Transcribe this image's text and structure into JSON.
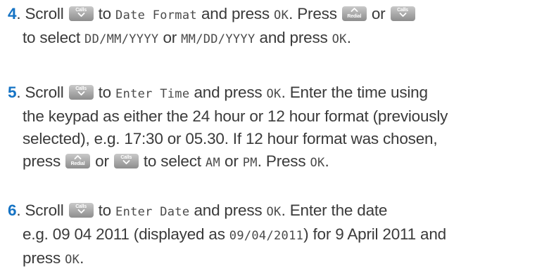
{
  "steps": [
    {
      "number": "4",
      "lines": [
        [
          {
            "t": "txt",
            "v": "Scroll "
          },
          {
            "t": "key",
            "k": "calls"
          },
          {
            "t": "txt",
            "v": " to "
          },
          {
            "t": "lcd",
            "v": "Date Format"
          },
          {
            "t": "txt",
            "v": " and press "
          },
          {
            "t": "lcd",
            "v": "OK"
          },
          {
            "t": "txt",
            "v": ". Press "
          },
          {
            "t": "key",
            "k": "redial"
          },
          {
            "t": "txt",
            "v": " or "
          },
          {
            "t": "key",
            "k": "calls"
          }
        ],
        [
          {
            "t": "txt",
            "v": "to select "
          },
          {
            "t": "lcd",
            "v": "DD/MM/YYYY"
          },
          {
            "t": "txt",
            "v": " or "
          },
          {
            "t": "lcd",
            "v": "MM/DD/YYYY"
          },
          {
            "t": "txt",
            "v": " and press "
          },
          {
            "t": "lcd",
            "v": "OK"
          },
          {
            "t": "txt",
            "v": "."
          }
        ]
      ]
    },
    {
      "number": "5",
      "lines": [
        [
          {
            "t": "txt",
            "v": "Scroll "
          },
          {
            "t": "key",
            "k": "calls"
          },
          {
            "t": "txt",
            "v": " to "
          },
          {
            "t": "lcd",
            "v": "Enter Time"
          },
          {
            "t": "txt",
            "v": " and press "
          },
          {
            "t": "lcd",
            "v": "OK"
          },
          {
            "t": "txt",
            "v": ". Enter the time using"
          }
        ],
        [
          {
            "t": "txt",
            "v": "the keypad as either the 24 hour or 12 hour format (previously"
          }
        ],
        [
          {
            "t": "txt",
            "v": "selected), e.g. 17:30 or 05.30. If 12 hour format was chosen,"
          }
        ],
        [
          {
            "t": "txt",
            "v": "press "
          },
          {
            "t": "key",
            "k": "redial"
          },
          {
            "t": "txt",
            "v": " or "
          },
          {
            "t": "key",
            "k": "calls"
          },
          {
            "t": "txt",
            "v": " to select "
          },
          {
            "t": "lcd",
            "v": "AM"
          },
          {
            "t": "txt",
            "v": " or "
          },
          {
            "t": "lcd",
            "v": "PM"
          },
          {
            "t": "txt",
            "v": ". Press "
          },
          {
            "t": "lcd",
            "v": "OK"
          },
          {
            "t": "txt",
            "v": "."
          }
        ]
      ]
    },
    {
      "number": "6",
      "lines": [
        [
          {
            "t": "txt",
            "v": "Scroll "
          },
          {
            "t": "key",
            "k": "calls"
          },
          {
            "t": "txt",
            "v": " to "
          },
          {
            "t": "lcd",
            "v": "Enter Date"
          },
          {
            "t": "txt",
            "v": " and press "
          },
          {
            "t": "lcd",
            "v": "OK"
          },
          {
            "t": "txt",
            "v": ". Enter the date"
          }
        ],
        [
          {
            "t": "txt",
            "v": "e.g. 09 04 2011 (displayed as "
          },
          {
            "t": "lcd",
            "v": "09/04/2011"
          },
          {
            "t": "txt",
            "v": ") for 9 April 2011 and"
          }
        ],
        [
          {
            "t": "txt",
            "v": "press "
          },
          {
            "t": "lcd",
            "v": "OK"
          },
          {
            "t": "txt",
            "v": "."
          }
        ]
      ]
    }
  ],
  "keys": {
    "calls": {
      "label": "Calls",
      "icon": "chevron-down-icon"
    },
    "redial": {
      "label": "Redial",
      "icon": "chevron-up-icon"
    }
  },
  "colors": {
    "step_number": "#1573c4",
    "body_text": "#3a3a3a",
    "key_top": "#c9c9c9",
    "key_bottom": "#8d8d8d"
  }
}
